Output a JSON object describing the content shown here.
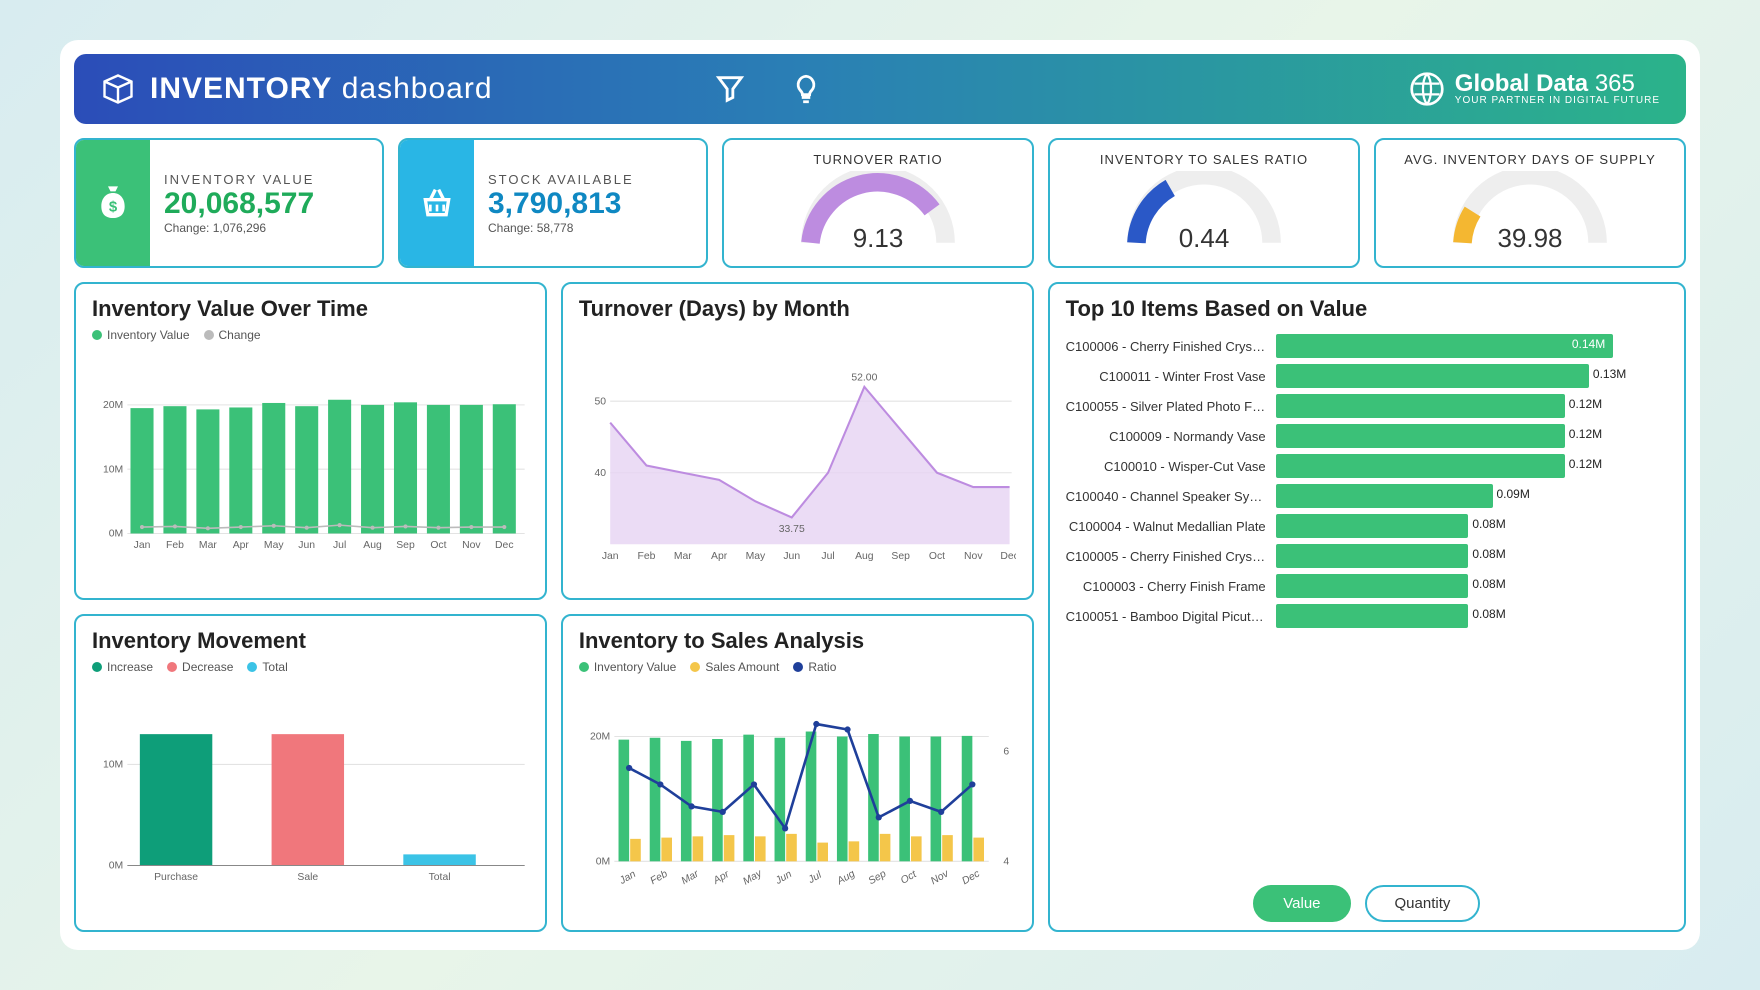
{
  "header": {
    "title_bold": "INVENTORY",
    "title_light": "dashboard",
    "brand_line1a": "Global Data",
    "brand_line1b": "365",
    "brand_line2": "YOUR PARTNER IN DIGITAL FUTURE"
  },
  "kpi": {
    "inventory_value": {
      "label": "INVENTORY VALUE",
      "value": "20,068,577",
      "change": "Change: 1,076,296"
    },
    "stock_available": {
      "label": "STOCK AVAILABLE",
      "value": "3,790,813",
      "change": "Change: 58,778"
    },
    "turnover": {
      "label": "TURNOVER RATIO",
      "value": "9.13",
      "fill": 0.78,
      "color": "#bd8ce0"
    },
    "inv_sales": {
      "label": "INVENTORY TO SALES RATIO",
      "value": "0.44",
      "fill": 0.3,
      "color": "#2a58c7"
    },
    "days_supply": {
      "label": "AVG. INVENTORY DAYS OF SUPPLY",
      "value": "39.98",
      "fill": 0.12,
      "color": "#f4b731"
    }
  },
  "panels": {
    "iv_over_time": {
      "title": "Inventory Value Over Time",
      "legend": [
        "Inventory Value",
        "Change"
      ]
    },
    "turnover_days": {
      "title": "Turnover (Days) by Month"
    },
    "movement": {
      "title": "Inventory Movement",
      "legend": [
        "Increase",
        "Decrease",
        "Total"
      ]
    },
    "inv_sales": {
      "title": "Inventory to Sales Analysis",
      "legend": [
        "Inventory Value",
        "Sales Amount",
        "Ratio"
      ]
    },
    "top_items": {
      "title": "Top 10 Items Based on Value",
      "btn_value": "Value",
      "btn_qty": "Quantity"
    }
  },
  "top_items": [
    {
      "name": "C100006 - Cherry Finished Cryst…",
      "value": 0.14
    },
    {
      "name": "C100011 - Winter Frost Vase",
      "value": 0.13
    },
    {
      "name": "C100055 - Silver Plated Photo Fr…",
      "value": 0.12
    },
    {
      "name": "C100009 - Normandy Vase",
      "value": 0.12
    },
    {
      "name": "C100010 - Wisper-Cut Vase",
      "value": 0.12
    },
    {
      "name": "C100040 - Channel Speaker Syst…",
      "value": 0.09
    },
    {
      "name": "C100004 - Walnut Medallian Plate",
      "value": 0.08
    },
    {
      "name": "C100005 - Cherry Finished Cryst…",
      "value": 0.08
    },
    {
      "name": "C100003 - Cherry Finish Frame",
      "value": 0.08
    },
    {
      "name": "C100051 - Bamboo Digital Picutr…",
      "value": 0.08
    }
  ],
  "chart_data": [
    {
      "id": "inventory_value_over_time",
      "type": "bar",
      "title": "Inventory Value Over Time",
      "categories": [
        "Jan",
        "Feb",
        "Mar",
        "Apr",
        "May",
        "Jun",
        "Jul",
        "Aug",
        "Sep",
        "Oct",
        "Nov",
        "Dec"
      ],
      "series": [
        {
          "name": "Inventory Value",
          "values": [
            19.5,
            19.8,
            19.3,
            19.6,
            20.3,
            19.8,
            20.8,
            20.0,
            20.4,
            20.0,
            20.0,
            20.1
          ]
        },
        {
          "name": "Change",
          "values": [
            1.0,
            1.1,
            0.8,
            1.0,
            1.2,
            0.9,
            1.3,
            0.9,
            1.1,
            0.9,
            1.0,
            1.0
          ]
        }
      ],
      "ylabel": "",
      "ylim": [
        0,
        22
      ],
      "yticks": [
        0,
        10,
        20
      ],
      "ytick_labels": [
        "0M",
        "10M",
        "20M"
      ]
    },
    {
      "id": "turnover_days_by_month",
      "type": "area",
      "title": "Turnover (Days) by Month",
      "categories": [
        "Jan",
        "Feb",
        "Mar",
        "Apr",
        "May",
        "Jun",
        "Jul",
        "Aug",
        "Sep",
        "Oct",
        "Nov",
        "Dec"
      ],
      "values": [
        47,
        41,
        40,
        39,
        36,
        33.75,
        40,
        52,
        46,
        40,
        38,
        38
      ],
      "annotations": [
        {
          "x": "Jun",
          "y": 33.75,
          "text": "33.75"
        },
        {
          "x": "Aug",
          "y": 52,
          "text": "52.00"
        }
      ],
      "ylim": [
        30,
        55
      ],
      "yticks": [
        40,
        50
      ]
    },
    {
      "id": "inventory_movement",
      "type": "bar",
      "title": "Inventory Movement",
      "categories": [
        "Purchase",
        "Sale",
        "Total"
      ],
      "series": [
        {
          "name": "Increase",
          "values": [
            13,
            0,
            0
          ],
          "color": "#0e9e79"
        },
        {
          "name": "Decrease",
          "values": [
            0,
            13,
            0
          ],
          "color": "#f0777c"
        },
        {
          "name": "Total",
          "values": [
            0,
            0,
            1.1
          ],
          "color": "#3bc3e6"
        }
      ],
      "ylim": [
        0,
        14
      ],
      "yticks": [
        0,
        10
      ],
      "ytick_labels": [
        "0M",
        "10M"
      ]
    },
    {
      "id": "inventory_to_sales",
      "type": "bar+line",
      "title": "Inventory to Sales Analysis",
      "categories": [
        "Jan",
        "Feb",
        "Mar",
        "Apr",
        "May",
        "Jun",
        "Jul",
        "Aug",
        "Sep",
        "Oct",
        "Nov",
        "Dec"
      ],
      "series": [
        {
          "name": "Inventory Value",
          "type": "bar",
          "values": [
            19.5,
            19.8,
            19.3,
            19.6,
            20.3,
            19.8,
            20.8,
            20.0,
            20.4,
            20.0,
            20.0,
            20.1
          ],
          "color": "#3bc178"
        },
        {
          "name": "Sales Amount",
          "type": "bar",
          "values": [
            3.6,
            3.8,
            4.0,
            4.2,
            4.0,
            4.4,
            3.0,
            3.2,
            4.4,
            4.0,
            4.2,
            3.8
          ],
          "color": "#f4c64a"
        },
        {
          "name": "Ratio",
          "type": "line",
          "axis": "right",
          "values": [
            5.7,
            5.4,
            5.0,
            4.9,
            5.4,
            4.6,
            6.5,
            6.4,
            4.8,
            5.1,
            4.9,
            5.4
          ],
          "color": "#1f3f9a"
        }
      ],
      "ylim_left": [
        0,
        22
      ],
      "yticks_left": [
        0,
        20
      ],
      "ytick_labels_left": [
        "0M",
        "20M"
      ],
      "ylim_right": [
        4,
        6.5
      ],
      "yticks_right": [
        4,
        6
      ]
    },
    {
      "id": "top_10_items",
      "type": "bar",
      "orientation": "horizontal",
      "title": "Top 10 Items Based on Value",
      "categories": [
        "C100006 - Cherry Finished Cryst…",
        "C100011 - Winter Frost Vase",
        "C100055 - Silver Plated Photo Fr…",
        "C100009 - Normandy Vase",
        "C100010 - Wisper-Cut Vase",
        "C100040 - Channel Speaker Syst…",
        "C100004 - Walnut Medallian Plate",
        "C100005 - Cherry Finished Cryst…",
        "C100003 - Cherry Finish Frame",
        "C100051 - Bamboo Digital Picutr…"
      ],
      "values": [
        0.14,
        0.13,
        0.12,
        0.12,
        0.12,
        0.09,
        0.08,
        0.08,
        0.08,
        0.08
      ],
      "value_suffix": "M",
      "xlim": [
        0,
        0.15
      ]
    }
  ]
}
